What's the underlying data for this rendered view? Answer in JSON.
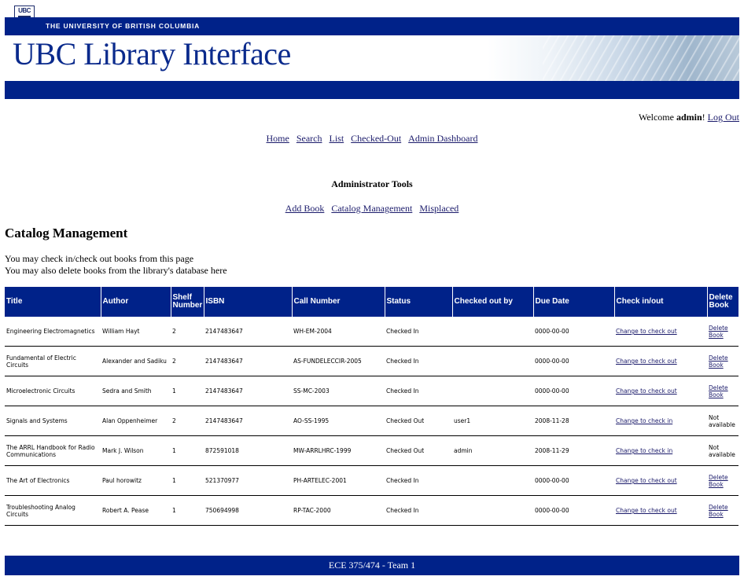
{
  "header": {
    "university": "THE UNIVERSITY OF BRITISH COLUMBIA",
    "crest_text": "UBC",
    "title": "UBC Library Interface"
  },
  "welcome": {
    "prefix": "Welcome ",
    "user": "admin",
    "suffix": "!",
    "logout": "Log Out"
  },
  "nav": [
    "Home",
    "Search",
    "List",
    "Checked-Out",
    "Admin Dashboard"
  ],
  "admin_tools": {
    "title": "Administrator Tools",
    "links": [
      "Add Book",
      "Catalog Management",
      "Misplaced"
    ]
  },
  "page": {
    "heading": "Catalog Management",
    "intro_lines": [
      "You may check in/check out books from this page",
      "You may also delete books from the library's database here"
    ]
  },
  "table": {
    "headers": [
      "Title",
      "Author",
      "Shelf Number",
      "ISBN",
      "Call Number",
      "Status",
      "Checked out by",
      "Due Date",
      "Check in/out",
      "Delete Book"
    ],
    "rows": [
      {
        "title": "Engineering Electromagnetics",
        "author": "William Hayt",
        "shelf": "2",
        "isbn": "2147483647",
        "call": "WH-EM-2004",
        "status": "Checked In",
        "by": "",
        "due": "0000-00-00",
        "action": "Change to check out",
        "delete": "Delete Book",
        "deletable": true
      },
      {
        "title": "Fundamental of Electric Circuits",
        "author": "Alexander and Sadiku",
        "shelf": "2",
        "isbn": "2147483647",
        "call": "AS-FUNDELECCIR-2005",
        "status": "Checked In",
        "by": "",
        "due": "0000-00-00",
        "action": "Change to check out",
        "delete": "Delete Book",
        "deletable": true
      },
      {
        "title": "Microelectronic Circuits",
        "author": "Sedra and Smith",
        "shelf": "1",
        "isbn": "2147483647",
        "call": "SS-MC-2003",
        "status": "Checked In",
        "by": "",
        "due": "0000-00-00",
        "action": "Change to check out",
        "delete": "Delete Book",
        "deletable": true
      },
      {
        "title": "Signals and Systems",
        "author": "Alan Oppenheimer",
        "shelf": "2",
        "isbn": "2147483647",
        "call": "AO-SS-1995",
        "status": "Checked Out",
        "by": "user1",
        "due": "2008-11-28",
        "action": "Change to check in",
        "delete": "Not available",
        "deletable": false
      },
      {
        "title": "The ARRL Handbook for Radio Communications",
        "author": "Mark J. Wilson",
        "shelf": "1",
        "isbn": "872591018",
        "call": "MW-ARRLHRC-1999",
        "status": "Checked Out",
        "by": "admin",
        "due": "2008-11-29",
        "action": "Change to check in",
        "delete": "Not available",
        "deletable": false
      },
      {
        "title": "The Art of Electronics",
        "author": "Paul horowitz",
        "shelf": "1",
        "isbn": "521370977",
        "call": "PH-ARTELEC-2001",
        "status": "Checked In",
        "by": "",
        "due": "0000-00-00",
        "action": "Change to check out",
        "delete": "Delete Book",
        "deletable": true
      },
      {
        "title": "Troubleshooting Analog Circuits",
        "author": "Robert A. Pease",
        "shelf": "1",
        "isbn": "750694998",
        "call": "RP-TAC-2000",
        "status": "Checked In",
        "by": "",
        "due": "0000-00-00",
        "action": "Change to check out",
        "delete": "Delete Book",
        "deletable": true
      }
    ]
  },
  "footer": {
    "text": "ECE 375/474  - Team 1"
  },
  "colors": {
    "brand_blue": "#002289",
    "link": "#1b1b6b",
    "title_blue": "#0a2a8c"
  }
}
